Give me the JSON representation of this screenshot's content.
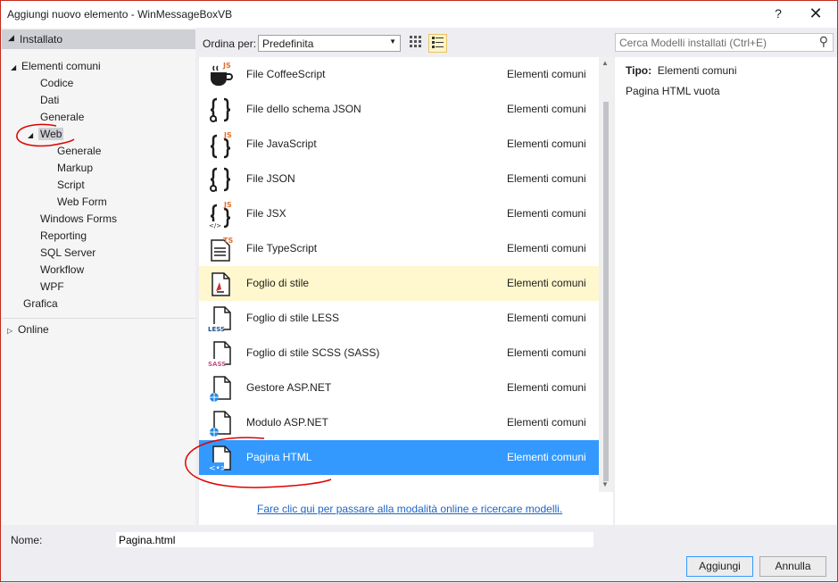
{
  "window": {
    "title": "Aggiungi nuovo elemento - WinMessageBoxVB",
    "help": "?",
    "close": "✕"
  },
  "tree": {
    "header": "Installato",
    "items": [
      {
        "label": "Elementi comuni",
        "exp": "◢"
      },
      {
        "label": "Codice"
      },
      {
        "label": "Dati"
      },
      {
        "label": "Generale"
      },
      {
        "label": "Web",
        "exp": "◢"
      },
      {
        "label": "Generale"
      },
      {
        "label": "Markup"
      },
      {
        "label": "Script"
      },
      {
        "label": "Web Form"
      },
      {
        "label": "Windows Forms"
      },
      {
        "label": "Reporting"
      },
      {
        "label": "SQL Server"
      },
      {
        "label": "Workflow"
      },
      {
        "label": "WPF"
      },
      {
        "label": "Grafica"
      },
      {
        "label": "Online",
        "exp": "▷"
      }
    ]
  },
  "toolbar": {
    "sort_label": "Ordina per:",
    "sort_value": "Predefinita",
    "search_placeholder": "Cerca Modelli installati (Ctrl+E)"
  },
  "templates": [
    {
      "name": "File CoffeeScript",
      "category": "Elementi comuni",
      "icon": "coffee-icon",
      "badge": "JS"
    },
    {
      "name": "File dello schema JSON",
      "category": "Elementi comuni",
      "icon": "json-schema-file-icon",
      "badge": ""
    },
    {
      "name": "File JavaScript",
      "category": "Elementi comuni",
      "icon": "javascript-file-icon",
      "badge": "JS"
    },
    {
      "name": "File JSON",
      "category": "Elementi comuni",
      "icon": "json-file-icon",
      "badge": ""
    },
    {
      "name": "File JSX",
      "category": "Elementi comuni",
      "icon": "jsx-file-icon",
      "badge": "JS"
    },
    {
      "name": "File TypeScript",
      "category": "Elementi comuni",
      "icon": "typescript-file-icon",
      "badge": "TS"
    },
    {
      "name": "Foglio di stile",
      "category": "Elementi comuni",
      "icon": "stylesheet-icon",
      "badge": ""
    },
    {
      "name": "Foglio di stile LESS",
      "category": "Elementi comuni",
      "icon": "less-stylesheet-icon",
      "badge": "LESS"
    },
    {
      "name": "Foglio di stile SCSS (SASS)",
      "category": "Elementi comuni",
      "icon": "scss-stylesheet-icon",
      "badge": "SASS"
    },
    {
      "name": "Gestore ASP.NET",
      "category": "Elementi comuni",
      "icon": "aspnet-handler-icon",
      "badge": ""
    },
    {
      "name": "Modulo ASP.NET",
      "category": "Elementi comuni",
      "icon": "aspnet-module-icon",
      "badge": ""
    },
    {
      "name": "Pagina HTML",
      "category": "Elementi comuni",
      "icon": "html-page-icon",
      "badge": ""
    }
  ],
  "online_link": "Fare clic qui per passare alla modalità online e ricercare modelli.",
  "details": {
    "type_label": "Tipo:",
    "type_value": "Elementi comuni",
    "description": "Pagina HTML vuota"
  },
  "bottom": {
    "name_label": "Nome:",
    "name_value": "Pagina.html",
    "add_label": "Aggiungi",
    "cancel_label": "Annulla"
  },
  "colors": {
    "selection": "#3399ff",
    "hover": "#fff7cd",
    "annotation": "#e00000",
    "link": "#1e64c8"
  }
}
